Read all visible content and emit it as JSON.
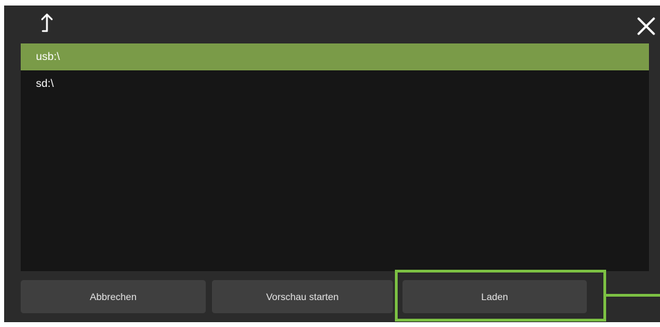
{
  "dialog": {
    "up_icon": "arrow-up-icon",
    "close_icon": "close-icon"
  },
  "file_list": {
    "items": [
      {
        "label": "usb:\\",
        "selected": true
      },
      {
        "label": "sd:\\",
        "selected": false
      }
    ]
  },
  "buttons": {
    "cancel_label": "Abbrechen",
    "preview_label": "Vorschau starten",
    "load_label": "Laden"
  },
  "colors": {
    "background": "#2b2b2b",
    "list_background": "#161616",
    "selected_row": "#7a9b48",
    "button": "#3f3f3f",
    "highlight": "#7cc043"
  }
}
